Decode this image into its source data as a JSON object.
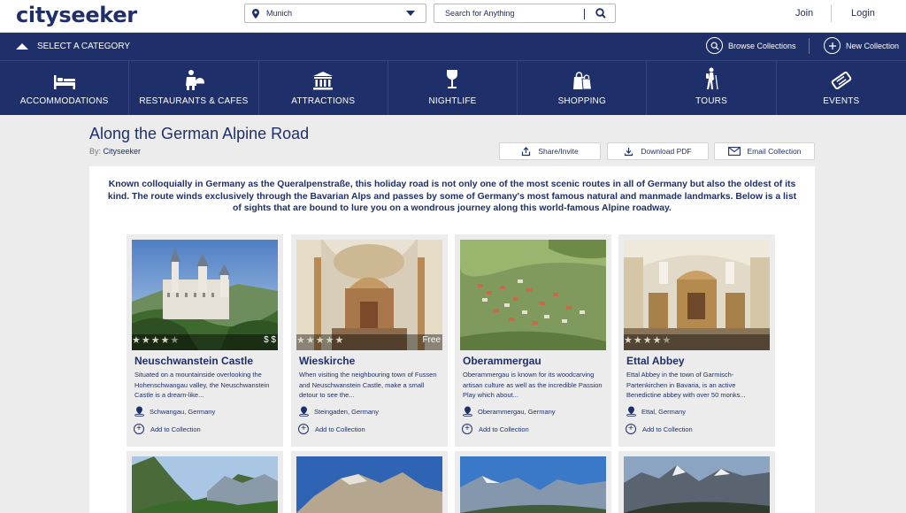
{
  "header": {
    "logo": "cityseeker",
    "city": "Munich",
    "search_placeholder": "Search for Anything",
    "join": "Join",
    "login": "Login"
  },
  "catbar": {
    "toggle": "SELECT A CATEGORY",
    "browse": "Browse Collections",
    "new": "New Collection"
  },
  "categories": [
    {
      "label": "ACCOMMODATIONS",
      "icon": "bed-icon"
    },
    {
      "label": "RESTAURANTS & CAFES",
      "icon": "waiter-icon"
    },
    {
      "label": "ATTRACTIONS",
      "icon": "museum-icon"
    },
    {
      "label": "NIGHTLIFE",
      "icon": "wine-glass-icon"
    },
    {
      "label": "SHOPPING",
      "icon": "shopping-bags-icon"
    },
    {
      "label": "TOURS",
      "icon": "hiker-icon"
    },
    {
      "label": "EVENTS",
      "icon": "ticket-icon"
    }
  ],
  "collection": {
    "title": "Along the German Alpine Road",
    "by_label": "By:",
    "author": "Cityseeker",
    "share": "Share/Invite",
    "download": "Download PDF",
    "email": "Email Collection",
    "intro": "Known colloquially in Germany as the Queralpenstraße, this holiday road is not only one of the most scenic routes in all of Germany but also the oldest of its kind. The route winds exclusively through the Bavarian Alps and passes by some of Germany's most famous natural and manmade landmarks. Below is a list of sights that are bound to lure you on a wondrous journey along this world-famous Alpine roadway."
  },
  "cards": [
    {
      "name": "Neuschwanstein Castle",
      "rating": 4.5,
      "price": "$ $",
      "desc": "Situated on a mountainside overlooking the Hohenschwangau valley, the Neuschwanstein Castle is a dream-like...",
      "location": "Schwangau, Germany",
      "add": "Add to Collection"
    },
    {
      "name": "Wieskirche",
      "rating": 5,
      "price": "Free",
      "desc": "When visiting the neighbouring town of Fussen and Neuschwanstein Castle, make a small detour to see the...",
      "location": "Steingaden, Germany",
      "add": "Add to Collection"
    },
    {
      "name": "Oberammergau",
      "rating": 0,
      "price": "",
      "desc": "Oberammergau is known for its woodcarving artisan culture as well as the incredible Passion Play which about...",
      "location": "Oberammergau, Germany",
      "add": "Add to Collection"
    },
    {
      "name": "Ettal Abbey",
      "rating": 4.5,
      "price": "",
      "desc": "Ettal Abbey in the town of Garmisch-Partenkirchen in Bavaria, is an active Benedictine abbey with over 50 monks...",
      "location": "Ettal, Germany",
      "add": "Add to Collection"
    }
  ],
  "colors": {
    "navy": "#1f2f6a",
    "background": "#ececec"
  }
}
